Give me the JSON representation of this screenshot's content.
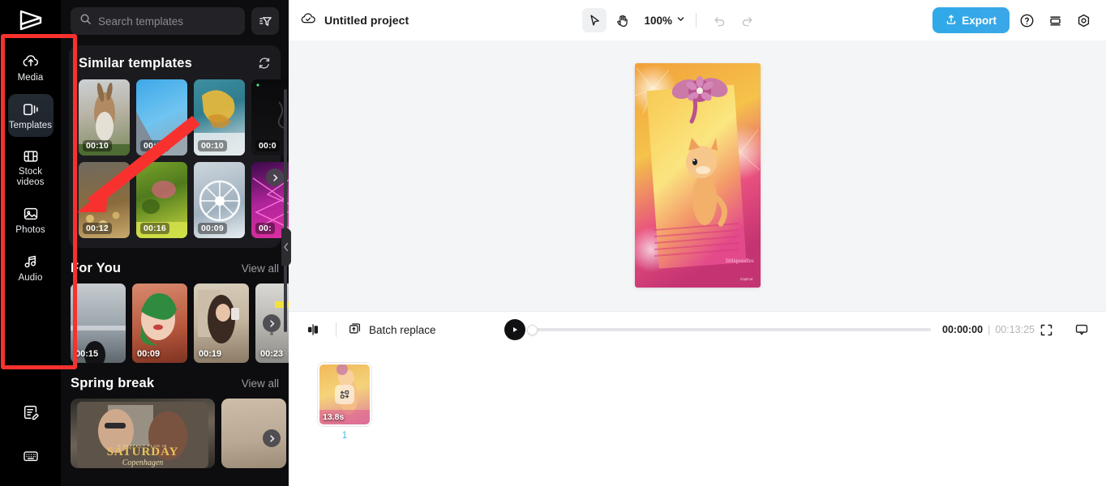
{
  "app": {
    "name": "CapCut Web Editor",
    "logo_icon": "capcut-logo-icon"
  },
  "left_rail": {
    "items": [
      {
        "label": "Media",
        "icon": "cloud-upload-icon",
        "active": false
      },
      {
        "label": "Templates",
        "icon": "templates-icon",
        "active": true
      },
      {
        "label": "Stock\nvideos",
        "icon": "film-strip-icon",
        "active": false
      },
      {
        "label": "Photos",
        "icon": "image-icon",
        "active": false
      },
      {
        "label": "Audio",
        "icon": "music-note-icon",
        "active": false
      }
    ],
    "bottom_items": [
      {
        "label": "",
        "icon": "notes-edit-icon"
      },
      {
        "label": "",
        "icon": "keyboard-icon"
      }
    ]
  },
  "panel": {
    "search": {
      "placeholder": "Search templates",
      "value": "",
      "icon": "search-icon"
    },
    "filter_icon": "filter-icon",
    "similar": {
      "title": "Similar templates",
      "refresh_icon": "refresh-icon",
      "templates": [
        {
          "duration": "00:10",
          "thumb": "rabbit-snow"
        },
        {
          "duration": "00:10",
          "thumb": "blue-sky-building"
        },
        {
          "duration": "00:10",
          "thumb": "yellow-smoke-earth"
        },
        {
          "duration": "00:0",
          "thumb": "dark-night"
        },
        {
          "duration": "00:12",
          "thumb": "bokeh-lights"
        },
        {
          "duration": "00:16",
          "thumb": "green-blur-flowers"
        },
        {
          "duration": "00:09",
          "thumb": "ferris-wheel"
        },
        {
          "duration": "00:",
          "thumb": "magenta-neon"
        }
      ],
      "next_arrow_icon": "chevron-right-icon"
    },
    "for_you": {
      "title": "For You",
      "view_all": "View all",
      "templates": [
        {
          "duration": "00:15",
          "thumb": "beach-silhouette"
        },
        {
          "duration": "00:09",
          "thumb": "green-hair-portrait"
        },
        {
          "duration": "00:19",
          "thumb": "mirror-selfie"
        },
        {
          "duration": "00:23",
          "thumb": "gray-text-overlay"
        }
      ],
      "next_arrow_icon": "chevron-right-icon"
    },
    "spring_break": {
      "title": "Spring break",
      "view_all": "View all",
      "templates": [
        {
          "caption_small": "A PERFECT PLAN IN",
          "caption_main": "SATURDAY",
          "caption_sub": "Copenhagen",
          "thumb": "saturday-copenhagen"
        },
        {
          "caption_small": "",
          "caption_main": "",
          "caption_sub": "",
          "thumb": "beige-portrait"
        }
      ],
      "next_arrow_icon": "chevron-right-icon"
    },
    "collapse_icon": "chevron-left-icon"
  },
  "topbar": {
    "cloud_icon": "cloud-saved-icon",
    "project_name": "Untitled project",
    "tools": [
      {
        "name": "select",
        "icon": "cursor-arrow-icon",
        "selected": true
      },
      {
        "name": "hand",
        "icon": "hand-icon",
        "selected": false
      }
    ],
    "zoom": {
      "value": "100%",
      "chevron_icon": "chevron-down-icon"
    },
    "undo_icon": "undo-icon",
    "redo_icon": "redo-icon",
    "export": {
      "label": "Export",
      "icon": "upload-icon",
      "color": "#2fa9e8"
    },
    "help_icon": "help-circle-icon",
    "layers_icon": "stacked-layers-icon",
    "settings_icon": "settings-gear-icon"
  },
  "stage": {
    "background": "#f4f5f7",
    "preview": {
      "description": "Orange kitten with pink bow and fireworks",
      "watermark": "CapCut"
    }
  },
  "timeline": {
    "split_icon": "split-clip-icon",
    "batch_replace": {
      "label": "Batch replace",
      "icon": "batch-replace-icon"
    },
    "play_icon": "play-icon",
    "current_time": "00:00:00",
    "separator": "|",
    "total_time": "00:13:25",
    "fullscreen_icon": "fullscreen-icon",
    "display_icon": "monitor-icon",
    "clips": [
      {
        "duration": "13.8s",
        "index": "1",
        "badge_icon": "replace-media-icon"
      }
    ]
  },
  "annotation": {
    "highlight_box_color": "#f8312f",
    "arrow_color": "#f8312f",
    "arrow_points": "from (238,146) to (97,261)"
  }
}
